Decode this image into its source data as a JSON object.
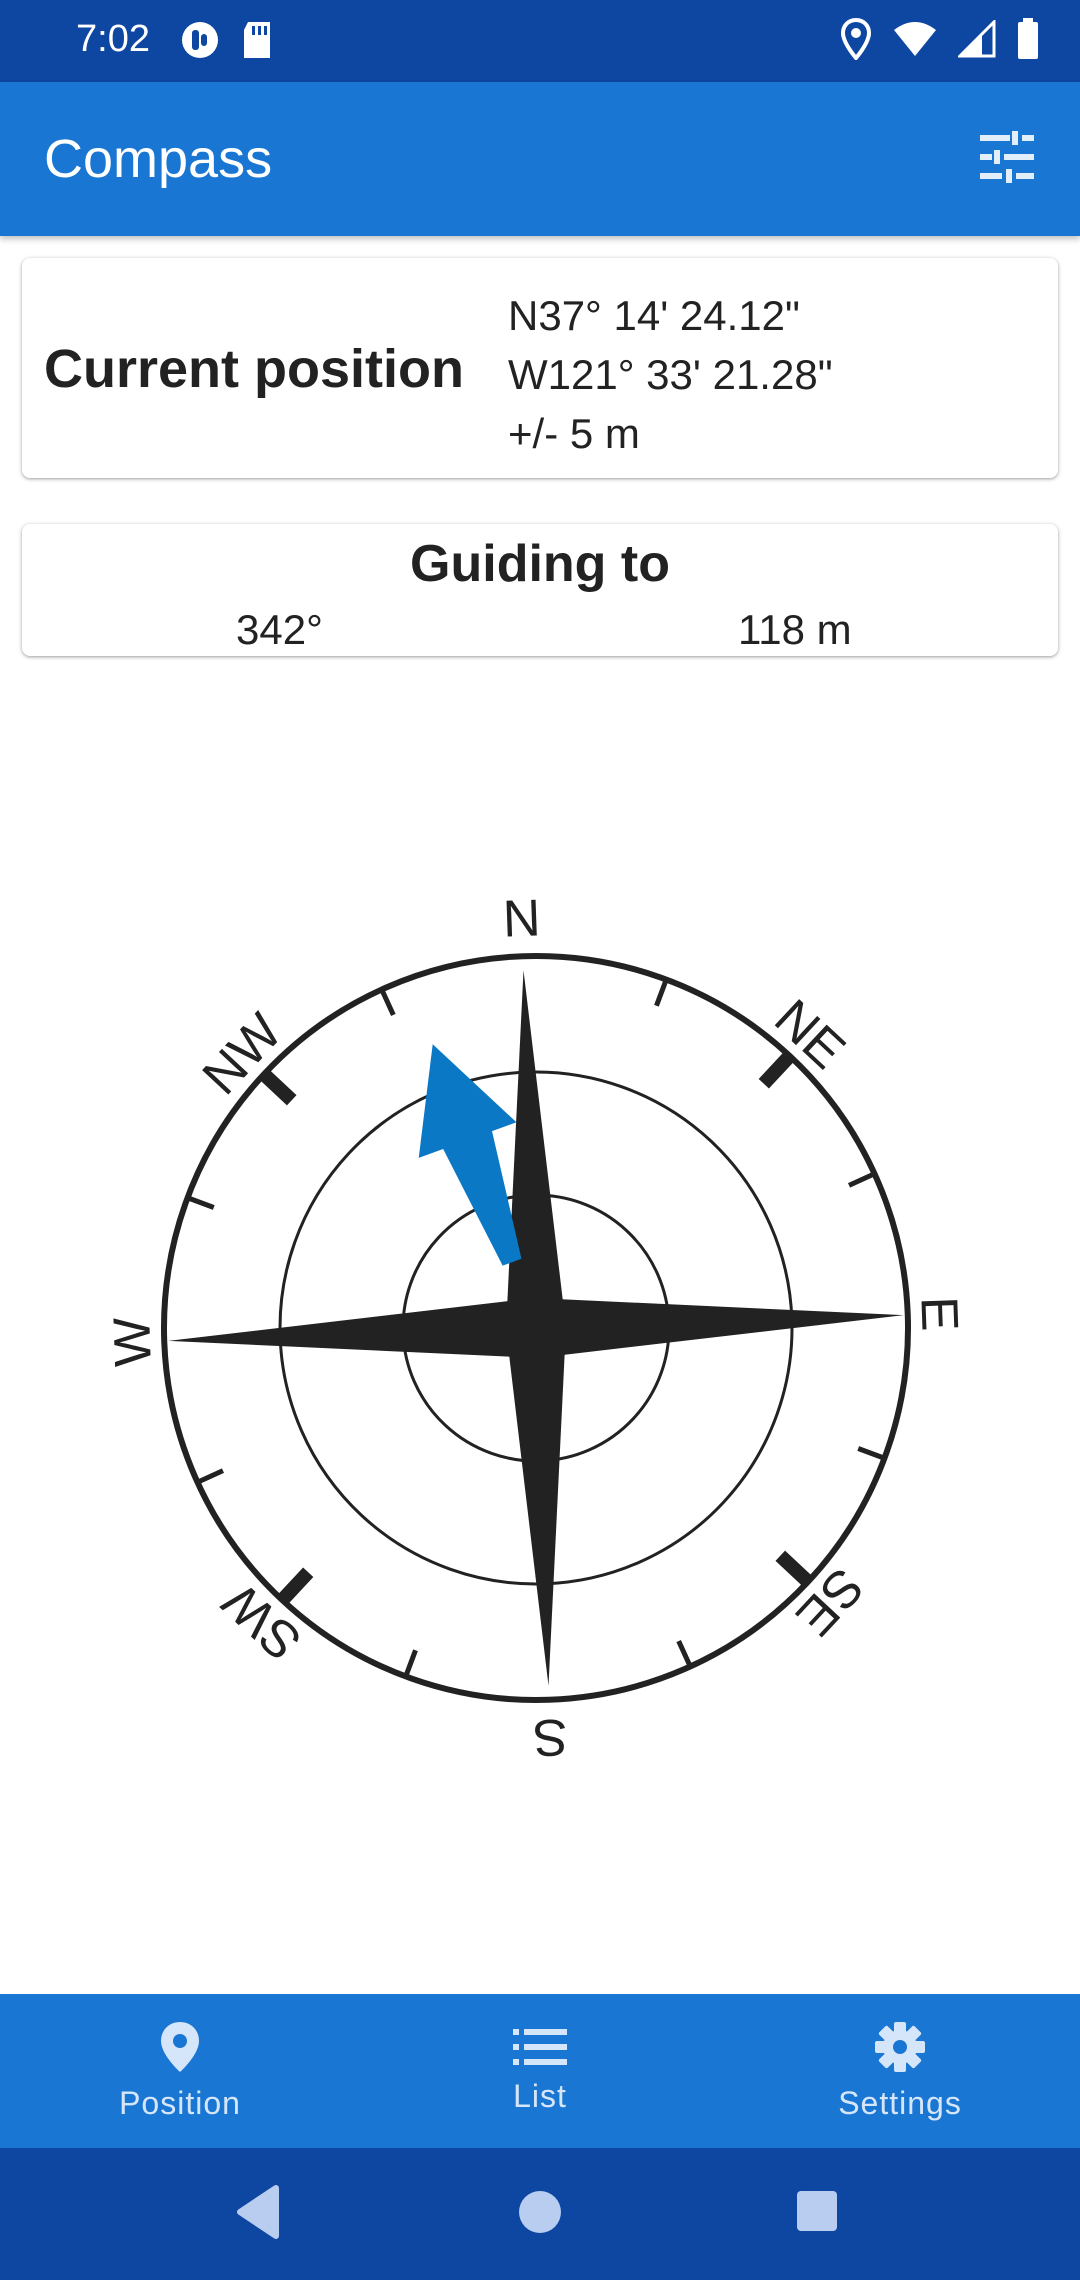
{
  "status_bar": {
    "time": "7:02",
    "left_icons": [
      "app-notification-icon",
      "sd-card-icon"
    ],
    "right_icons": [
      "location-icon",
      "wifi-icon",
      "cell-signal-icon",
      "battery-icon"
    ]
  },
  "app_bar": {
    "title": "Compass",
    "action_icon": "tune-icon"
  },
  "position_card": {
    "label": "Current position",
    "latitude": "N37° 14' 24.12\"",
    "longitude": "W121° 33' 21.28\"",
    "accuracy": "+/- 5 m"
  },
  "guide_card": {
    "title": "Guiding to",
    "bearing": "342°",
    "distance": "118 m"
  },
  "compass": {
    "labels": [
      "N",
      "NE",
      "E",
      "SE",
      "S",
      "SW",
      "W",
      "NW"
    ],
    "heading_deg": -2,
    "target_bearing_deg": 342,
    "target_arrow_color": "#0b78c6"
  },
  "bottom_nav": {
    "items": [
      {
        "label": "Position",
        "icon": "location-pin-icon"
      },
      {
        "label": "List",
        "icon": "list-icon"
      },
      {
        "label": "Settings",
        "icon": "gear-icon"
      }
    ]
  },
  "colors": {
    "status_bar": "#0d47a1",
    "app_bar": "#1976d2",
    "accent": "#0b78c6"
  }
}
